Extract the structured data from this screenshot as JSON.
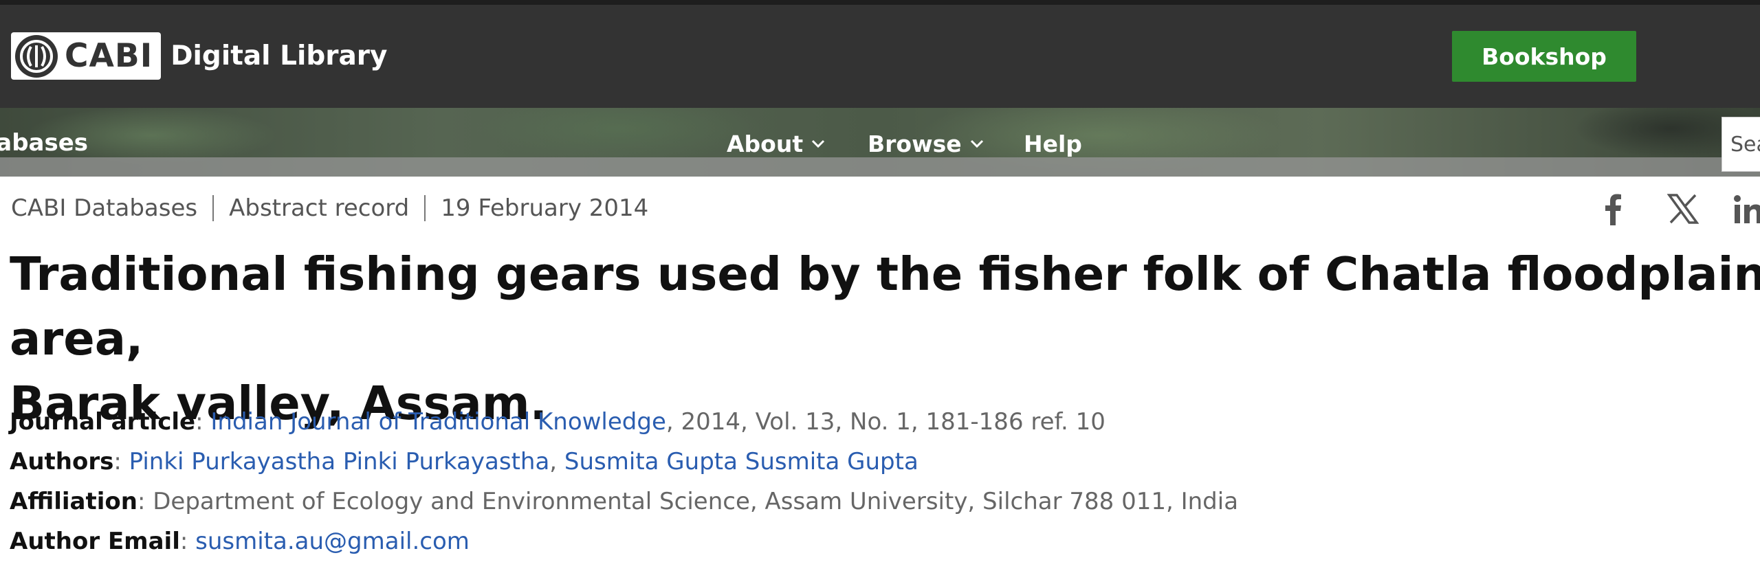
{
  "header": {
    "logo_text": "CABI",
    "site_name": "Digital Library",
    "bookshop_label": "Bookshop"
  },
  "nav": {
    "databases_label": "tabases",
    "about_label": "About",
    "browse_label": "Browse",
    "help_label": "Help",
    "search_placeholder": "Sea"
  },
  "breadcrumb": {
    "items": [
      "CABI Databases",
      "Abstract record",
      "19 February 2014"
    ]
  },
  "share": {
    "icons": [
      "facebook-icon",
      "x-icon",
      "linkedin-icon"
    ]
  },
  "article": {
    "title_line1": "Traditional fishing gears used by the fisher folk of Chatla floodplain area,",
    "title_line2": "Barak valley, Assam.",
    "journal_label": "Journal article",
    "journal_name": "Indian Journal of Traditional Knowledge",
    "journal_details": ", 2014, Vol. 13, No. 1, 181-186 ref. 10",
    "authors_label": "Authors",
    "author_1": "Pinki Purkayastha Pinki Purkayastha",
    "author_2": "Susmita Gupta Susmita Gupta",
    "affiliation_label": "Affiliation",
    "affiliation_value": "Department of Ecology and Environmental Science, Assam University, Silchar 788 011, India",
    "email_label": "Author Email",
    "email_value": "susmita.au@gmail.com"
  },
  "colors": {
    "header_bg": "#333333",
    "bookshop_green": "#2f8a2f",
    "link_blue": "#2a5db0"
  }
}
